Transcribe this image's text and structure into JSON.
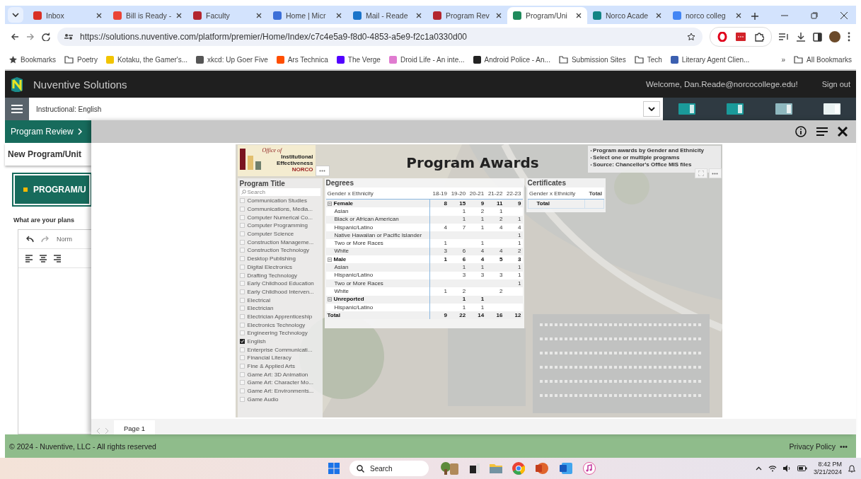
{
  "browser": {
    "tabs": [
      {
        "title": "Inbox",
        "color": "#d93025",
        "selected": false
      },
      {
        "title": "Bill is Ready -",
        "color": "#ea4335",
        "selected": false
      },
      {
        "title": "Faculty",
        "color": "#b3262e",
        "selected": false
      },
      {
        "title": "Home | Micr",
        "color": "#3b6fd8",
        "selected": false
      },
      {
        "title": "Mail - Reade",
        "color": "#1a73c9",
        "selected": false
      },
      {
        "title": "Program Rev",
        "color": "#b3262e",
        "selected": false
      },
      {
        "title": "Program/Uni",
        "color": "#1f8a5c",
        "selected": true
      },
      {
        "title": "Norco Acade",
        "color": "#138484",
        "selected": false
      },
      {
        "title": "norco colleg",
        "color": "#4285f4",
        "selected": false
      }
    ],
    "url": "https://solutions.nuventive.com/platform/premier/Home/Index/c7c4e5a9-f8d0-4853-a5e9-f2c1a0330d00",
    "bookmarks": [
      {
        "kind": "star",
        "label": "Bookmarks"
      },
      {
        "kind": "folder",
        "label": "Poetry"
      },
      {
        "kind": "site",
        "label": "Kotaku, the Gamer's...",
        "color": "#f2c400"
      },
      {
        "kind": "site",
        "label": "xkcd: Up Goer Five",
        "color": "#555555"
      },
      {
        "kind": "site",
        "label": "Ars Technica",
        "color": "#ff4e00"
      },
      {
        "kind": "site",
        "label": "The Verge",
        "color": "#5200ff"
      },
      {
        "kind": "site",
        "label": "Droid Life - An inte...",
        "color": "#e07bd0"
      },
      {
        "kind": "site",
        "label": "Android Police - An...",
        "color": "#222222"
      },
      {
        "kind": "folder",
        "label": "Submission Sites"
      },
      {
        "kind": "folder",
        "label": "Tech"
      },
      {
        "kind": "site",
        "label": "Literary Agent Clien...",
        "color": "#3b5fb0"
      }
    ],
    "more_bookmarks": "»",
    "all_bookmarks": "All Bookmarks"
  },
  "app": {
    "brand": "Nuventive Solutions",
    "welcome": "Welcome, Dan.Reade@norcocollege.edu!",
    "sign_out": "Sign out",
    "unit_select": "Instructional: English",
    "breadcrumb": "Program Review",
    "page_title": "New Program/Unit",
    "section_button": "PROGRAM/U",
    "question": "What are your plans",
    "editor_style": "Norm"
  },
  "report": {
    "logo": {
      "script": "Office of",
      "lines": [
        "Institutional",
        "Effectiveness"
      ],
      "college": "NORCO"
    },
    "title": "Program Awards",
    "notes": [
      "Program awards by Gender and Ethnicity",
      "Select one or multiple programs",
      "Source: Chancellor's Office MIS files"
    ],
    "slicer": {
      "title": "Program Title",
      "placeholder": "Search",
      "items": [
        {
          "label": "Communication Studies",
          "checked": false
        },
        {
          "label": "Communications, Media...",
          "checked": false
        },
        {
          "label": "Computer Numerical Co...",
          "checked": false
        },
        {
          "label": "Computer Programming",
          "checked": false
        },
        {
          "label": "Computer Science",
          "checked": false
        },
        {
          "label": "Construction Manageme...",
          "checked": false
        },
        {
          "label": "Construction Technology",
          "checked": false
        },
        {
          "label": "Desktop Publishing",
          "checked": false
        },
        {
          "label": "Digital Electronics",
          "checked": false
        },
        {
          "label": "Drafting Technology",
          "checked": false
        },
        {
          "label": "Early Childhood Education",
          "checked": false
        },
        {
          "label": "Early Childhood Interven...",
          "checked": false
        },
        {
          "label": "Electrical",
          "checked": false
        },
        {
          "label": "Electrician",
          "checked": false
        },
        {
          "label": "Electrician Apprenticeship",
          "checked": false
        },
        {
          "label": "Electronics Technology",
          "checked": false
        },
        {
          "label": "Engineering Technology",
          "checked": false
        },
        {
          "label": "English",
          "checked": true
        },
        {
          "label": "Enterprise Communicati...",
          "checked": false
        },
        {
          "label": "Financial Literacy",
          "checked": false
        },
        {
          "label": "Fine & Applied Arts",
          "checked": false
        },
        {
          "label": "Game Art: 3D Animation",
          "checked": false
        },
        {
          "label": "Game Art: Character Mo...",
          "checked": false
        },
        {
          "label": "Game Art: Environments...",
          "checked": false
        },
        {
          "label": "Game Audio",
          "checked": false
        }
      ]
    },
    "degrees": {
      "title": "Degrees",
      "columns": [
        "Gender x Ethnicity",
        "18-19",
        "19-20",
        "20-21",
        "21-22",
        "22-23"
      ],
      "rows": [
        {
          "kind": "group",
          "label": "Female",
          "expanded": true,
          "values": {
            "18-19": "8",
            "19-20": "15",
            "20-21": "9",
            "21-22": "11",
            "22-23": "9"
          }
        },
        {
          "kind": "item",
          "label": "Asian",
          "values": {
            "19-20": "1",
            "20-21": "2",
            "21-22": "1"
          }
        },
        {
          "kind": "item",
          "label": "Black or African American",
          "values": {
            "19-20": "1",
            "20-21": "1",
            "21-22": "2",
            "22-23": "1"
          }
        },
        {
          "kind": "item",
          "label": "Hispanic/Latino",
          "values": {
            "18-19": "4",
            "19-20": "7",
            "20-21": "1",
            "21-22": "4",
            "22-23": "4"
          }
        },
        {
          "kind": "item",
          "label": "Native Hawaiian or Pacific Islander",
          "values": {
            "22-23": "1"
          }
        },
        {
          "kind": "item",
          "label": "Two or More Races",
          "values": {
            "18-19": "1",
            "20-21": "1",
            "22-23": "1"
          }
        },
        {
          "kind": "item",
          "label": "White",
          "values": {
            "18-19": "3",
            "19-20": "6",
            "20-21": "4",
            "21-22": "4",
            "22-23": "2"
          }
        },
        {
          "kind": "group",
          "label": "Male",
          "expanded": true,
          "values": {
            "18-19": "1",
            "19-20": "6",
            "20-21": "4",
            "21-22": "5",
            "22-23": "3"
          }
        },
        {
          "kind": "item",
          "label": "Asian",
          "values": {
            "19-20": "1",
            "20-21": "1",
            "22-23": "1"
          }
        },
        {
          "kind": "item",
          "label": "Hispanic/Latino",
          "values": {
            "19-20": "3",
            "20-21": "3",
            "21-22": "3",
            "22-23": "1"
          }
        },
        {
          "kind": "item",
          "label": "Two or More Races",
          "values": {
            "22-23": "1"
          }
        },
        {
          "kind": "item",
          "label": "White",
          "values": {
            "18-19": "1",
            "19-20": "2",
            "21-22": "2"
          }
        },
        {
          "kind": "group",
          "label": "Unreported",
          "expanded": true,
          "values": {
            "19-20": "1",
            "20-21": "1"
          }
        },
        {
          "kind": "item",
          "label": "Hispanic/Latino",
          "values": {
            "19-20": "1",
            "20-21": "1"
          }
        },
        {
          "kind": "total",
          "label": "Total",
          "values": {
            "18-19": "9",
            "19-20": "22",
            "20-21": "14",
            "21-22": "16",
            "22-23": "12"
          }
        }
      ]
    },
    "certificates": {
      "title": "Certificates",
      "columns": [
        "Gender x Ethnicity",
        "Total"
      ],
      "rows": [
        {
          "kind": "total",
          "label": "Total"
        }
      ]
    },
    "pages": [
      {
        "label": "Page 1",
        "selected": true
      }
    ]
  },
  "footer": {
    "copyright": "© 2024 - Nuventive, LLC - All rights reserved",
    "privacy": "Privacy Policy",
    "more": "•••"
  },
  "taskbar": {
    "search": "Search",
    "time": "8:42 PM",
    "date": "3/21/2024"
  }
}
